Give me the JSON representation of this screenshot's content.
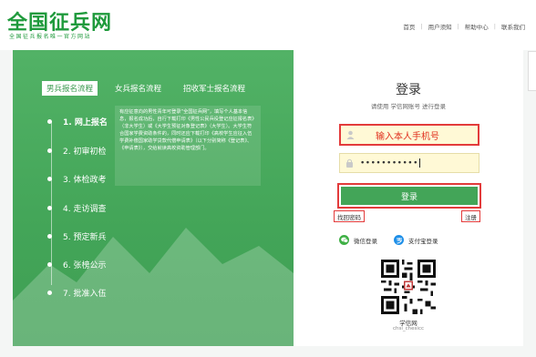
{
  "header": {
    "logo_title": "全国征兵网",
    "logo_subtitle": "全国征兵报名唯一官方网站",
    "nav": [
      "首页",
      "用户须知",
      "帮助中心",
      "联系我们"
    ]
  },
  "left": {
    "tabs": [
      {
        "label": "男兵报名流程",
        "active": true
      },
      {
        "label": "女兵报名流程",
        "active": false
      },
      {
        "label": "招收军士报名流程",
        "active": false
      }
    ],
    "steps": [
      {
        "label": "1. 网上报名",
        "active": true
      },
      {
        "label": "2. 初审初检",
        "active": false
      },
      {
        "label": "3. 体检政考",
        "active": false
      },
      {
        "label": "4. 走访调查",
        "active": false
      },
      {
        "label": "5. 预定新兵",
        "active": false
      },
      {
        "label": "6. 张榜公示",
        "active": false
      },
      {
        "label": "7. 批准入伍",
        "active": false
      }
    ],
    "description": "有应征意向的男性青年可登录“全国征兵网”，填写个人基本信息，报名成功后，自行下载打印《男性公民兵役登记应征报名表》（非大学生）或《大学生预征对象登记表》（大学生）。大学生符合国家学费资助条件的，同时还应下载打印《高校学生应征入伍学费补偿国家助学贷款代偿申请表》（以下分别简称《登记表》、《申请表》），交给就读高校资助管理部门。"
  },
  "login": {
    "title": "登录",
    "subtitle": "请使用 学信网账号 进行登录",
    "phone_hint": "输入本人手机号",
    "password_mask": "•••••••••••",
    "login_button": "登录",
    "forgot_link": "找回密码",
    "register_link": "注册",
    "wechat_label": "微信登录",
    "alipay_label": "支付宝登录",
    "qr_label": "学信网",
    "qr_sub": "chsi_chesicc"
  },
  "colors": {
    "brand_green": "#43a558",
    "highlight_red": "#e33b3b",
    "field_yellow": "#fff9d6"
  }
}
